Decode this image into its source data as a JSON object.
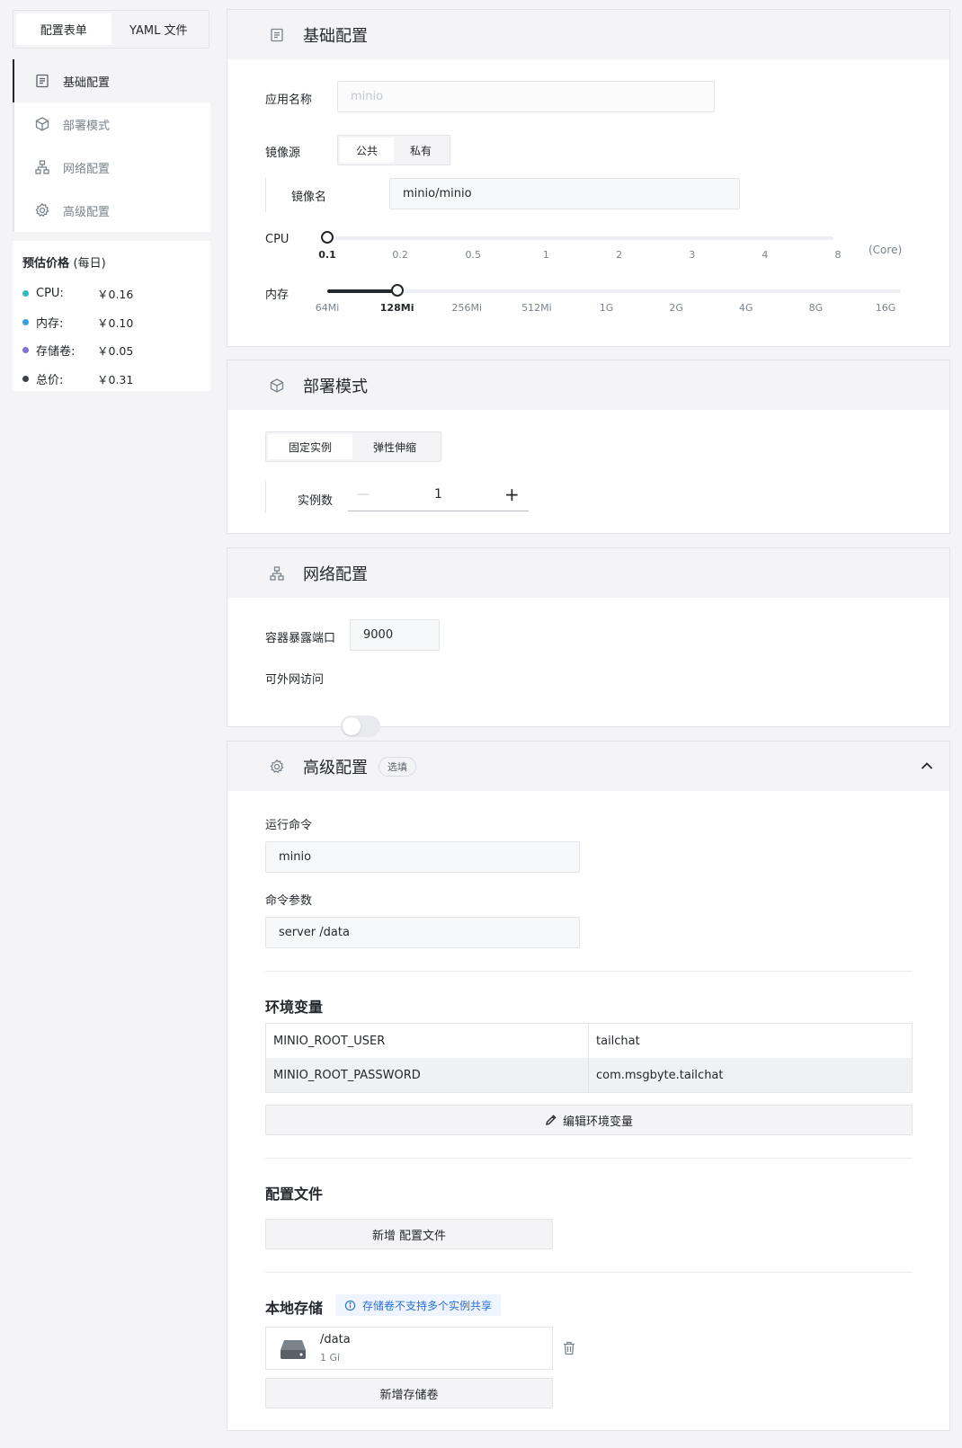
{
  "mode_tabs": [
    "配置表单",
    "YAML 文件"
  ],
  "nav": [
    {
      "label": "基础配置",
      "icon": "document-icon"
    },
    {
      "label": "部署模式",
      "icon": "cube-icon"
    },
    {
      "label": "网络配置",
      "icon": "network-icon"
    },
    {
      "label": "高级配置",
      "icon": "gear-icon"
    }
  ],
  "price": {
    "title": "预估价格",
    "title_sub": "(每日)",
    "items": [
      {
        "label": "CPU:",
        "value": "￥0.16",
        "color": "#33bababa"
      },
      {
        "label": "内存:",
        "value": "￥0.10",
        "color": "#36a1e0"
      },
      {
        "label": "存储卷:",
        "value": "￥0.05",
        "color": "#8172d8"
      },
      {
        "label": "总价:",
        "value": "￥0.31",
        "color": "#3c4047"
      }
    ]
  },
  "basic": {
    "title": "基础配置",
    "app_name_label": "应用名称",
    "app_name_placeholder": "minio",
    "image_source_label": "镜像源",
    "image_source_options": [
      "公共",
      "私有"
    ],
    "image_name_label": "镜像名",
    "image_name_value": "minio/minio",
    "cpu_label": "CPU",
    "cpu_ticks": [
      "0.1",
      "0.2",
      "0.5",
      "1",
      "2",
      "3",
      "4",
      "8"
    ],
    "cpu_unit": "(Core)",
    "cpu_selected": "0.1",
    "mem_label": "内存",
    "mem_ticks": [
      "64Mi",
      "128Mi",
      "256Mi",
      "512Mi",
      "1G",
      "2G",
      "4G",
      "8G",
      "16G"
    ],
    "mem_selected": "128Mi"
  },
  "deploy": {
    "title": "部署模式",
    "options": [
      "固定实例",
      "弹性伸缩"
    ],
    "replicas_label": "实例数",
    "replicas_value": "1",
    "minus": "—",
    "plus": "+"
  },
  "network": {
    "title": "网络配置",
    "port_label": "容器暴露端口",
    "port_value": "9000",
    "public_label": "可外网访问",
    "public_enabled": false
  },
  "advanced": {
    "title": "高级配置",
    "badge": "选填",
    "command_label": "运行命令",
    "command_value": "minio",
    "args_label": "命令参数",
    "args_value": "server /data",
    "env_title": "环境变量",
    "env": [
      {
        "key": "MINIO_ROOT_USER",
        "value": "tailchat"
      },
      {
        "key": "MINIO_ROOT_PASSWORD",
        "value": "com.msgbyte.tailchat"
      }
    ],
    "edit_env_btn": "编辑环境变量",
    "config_title": "配置文件",
    "add_config_btn": "新增 配置文件",
    "storage_title": "本地存储",
    "storage_tip": "存储卷不支持多个实例共享",
    "volumes": [
      {
        "path": "/data",
        "size": "1 Gi"
      }
    ],
    "add_volume_btn": "新增存储卷"
  }
}
